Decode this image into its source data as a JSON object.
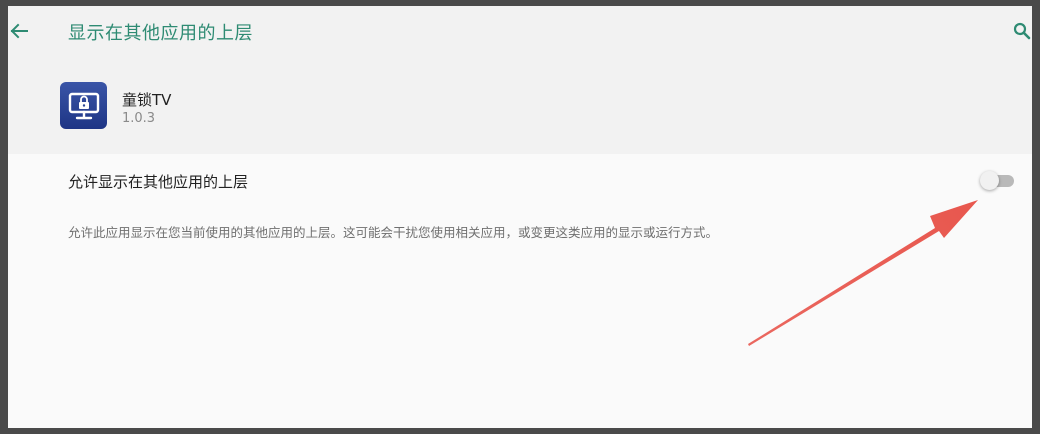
{
  "header": {
    "title": "显示在其他应用的上层",
    "back_icon": "arrow-back-icon",
    "search_icon": "search-icon",
    "accent_color": "#2e8b73"
  },
  "app": {
    "name": "童锁TV",
    "version": "1.0.3",
    "icon": "tv-lock-icon"
  },
  "setting": {
    "label": "允许显示在其他应用的上层",
    "enabled": false,
    "description": "允许此应用显示在您当前使用的其他应用的上层。这可能会干扰您使用相关应用，或变更这类应用的显示或运行方式。"
  },
  "annotation": {
    "color": "#e8574e",
    "points_to": "overlay-permission-toggle"
  }
}
